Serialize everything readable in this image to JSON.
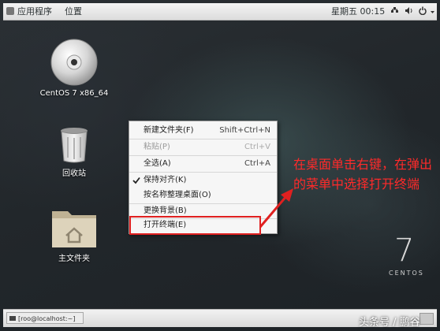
{
  "topbar": {
    "apps_label": "应用程序",
    "places_label": "位置",
    "clock": "星期五 00:15"
  },
  "desktop": {
    "icons": [
      {
        "label": "CentOS 7 x86_64",
        "icon": "optical-disc-icon"
      },
      {
        "label": "回收站",
        "icon": "trash-icon"
      },
      {
        "label": "主文件夹",
        "icon": "home-folder-icon"
      }
    ]
  },
  "context_menu": {
    "items": [
      {
        "label": "新建文件夹(F)",
        "accel": "Shift+Ctrl+N",
        "enabled": true
      },
      {
        "label": "粘贴(P)",
        "accel": "Ctrl+V",
        "enabled": false
      },
      {
        "label": "全选(A)",
        "accel": "Ctrl+A",
        "enabled": true
      },
      {
        "label": "保持对齐(K)",
        "accel": "",
        "enabled": true,
        "checked": true
      },
      {
        "label": "按名称整理桌面(O)",
        "accel": "",
        "enabled": true
      },
      {
        "label": "更换背景(B)",
        "accel": "",
        "enabled": true
      },
      {
        "label": "打开终端(E)",
        "accel": "",
        "enabled": true
      }
    ]
  },
  "annotation": {
    "text": "在桌面单击右键，在弹出的菜单中选择打开终端",
    "color": "#ff2a2a"
  },
  "branding": {
    "version_numeral": "7",
    "wordmark": "CENTOS"
  },
  "taskbar": {
    "window_label": "[roo@localhost:~]"
  },
  "watermark": "头条号 / 鹏谷"
}
